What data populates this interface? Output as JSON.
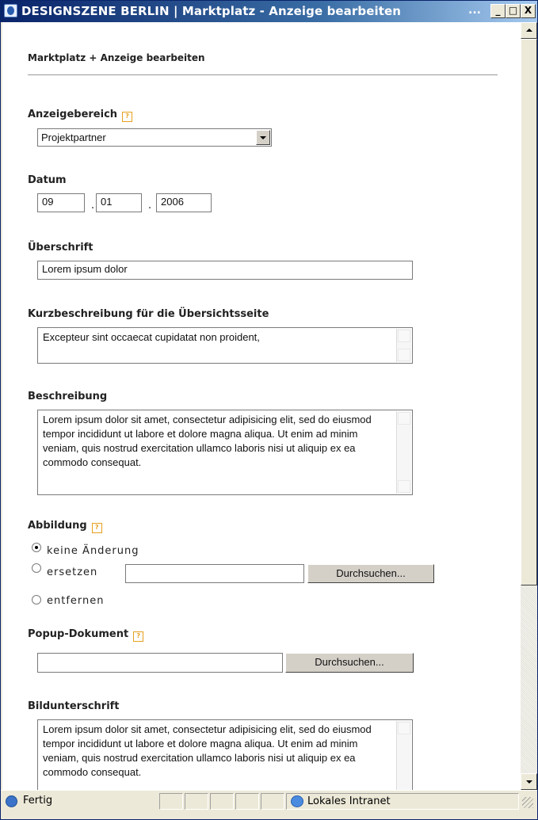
{
  "window": {
    "title": "DESIGNSZENE BERLIN | Marktplatz - Anzeige bearbeiten",
    "title_ellipsis": "...",
    "minimize": "_",
    "maximize": "□",
    "close": "X"
  },
  "page": {
    "breadcrumb": "Marktplatz + Anzeige bearbeiten"
  },
  "form": {
    "anzeigebereich": {
      "label": "Anzeigebereich",
      "help": "?",
      "value": "Projektpartner"
    },
    "datum": {
      "label": "Datum",
      "day": "09",
      "month": "01",
      "year": "2006",
      "separator": "."
    },
    "ueberschrift": {
      "label": "Überschrift",
      "value": "Lorem ipsum dolor"
    },
    "kurzbeschreibung": {
      "label": "Kurzbeschreibung für die Übersichtsseite",
      "value": "Excepteur sint occaecat cupidatat non proident,"
    },
    "beschreibung": {
      "label": "Beschreibung",
      "value": "Lorem ipsum dolor sit amet, consectetur adipisicing elit, sed do eiusmod tempor incididunt ut labore et dolore magna aliqua. Ut enim ad minim veniam, quis nostrud exercitation ullamco laboris nisi ut aliquip ex ea commodo consequat."
    },
    "abbildung": {
      "label": "Abbildung",
      "help": "?",
      "options": [
        "keine Änderung",
        "ersetzen",
        "entfernen"
      ],
      "selected": "keine Änderung",
      "file_value": "",
      "browse_label": "Durchsuchen..."
    },
    "popup": {
      "label": "Popup-Dokument",
      "help": "?",
      "file_value": "",
      "browse_label": "Durchsuchen..."
    },
    "bildunterschrift": {
      "label": "Bildunterschrift",
      "value": "Lorem ipsum dolor sit amet, consectetur adipisicing elit, sed do eiusmod tempor incididunt ut labore et dolore magna aliqua. Ut enim ad minim veniam, quis nostrud exercitation ullamco laboris nisi ut aliquip ex ea commodo consequat."
    }
  },
  "statusbar": {
    "status": "Fertig",
    "zone": "Lokales Intranet"
  }
}
